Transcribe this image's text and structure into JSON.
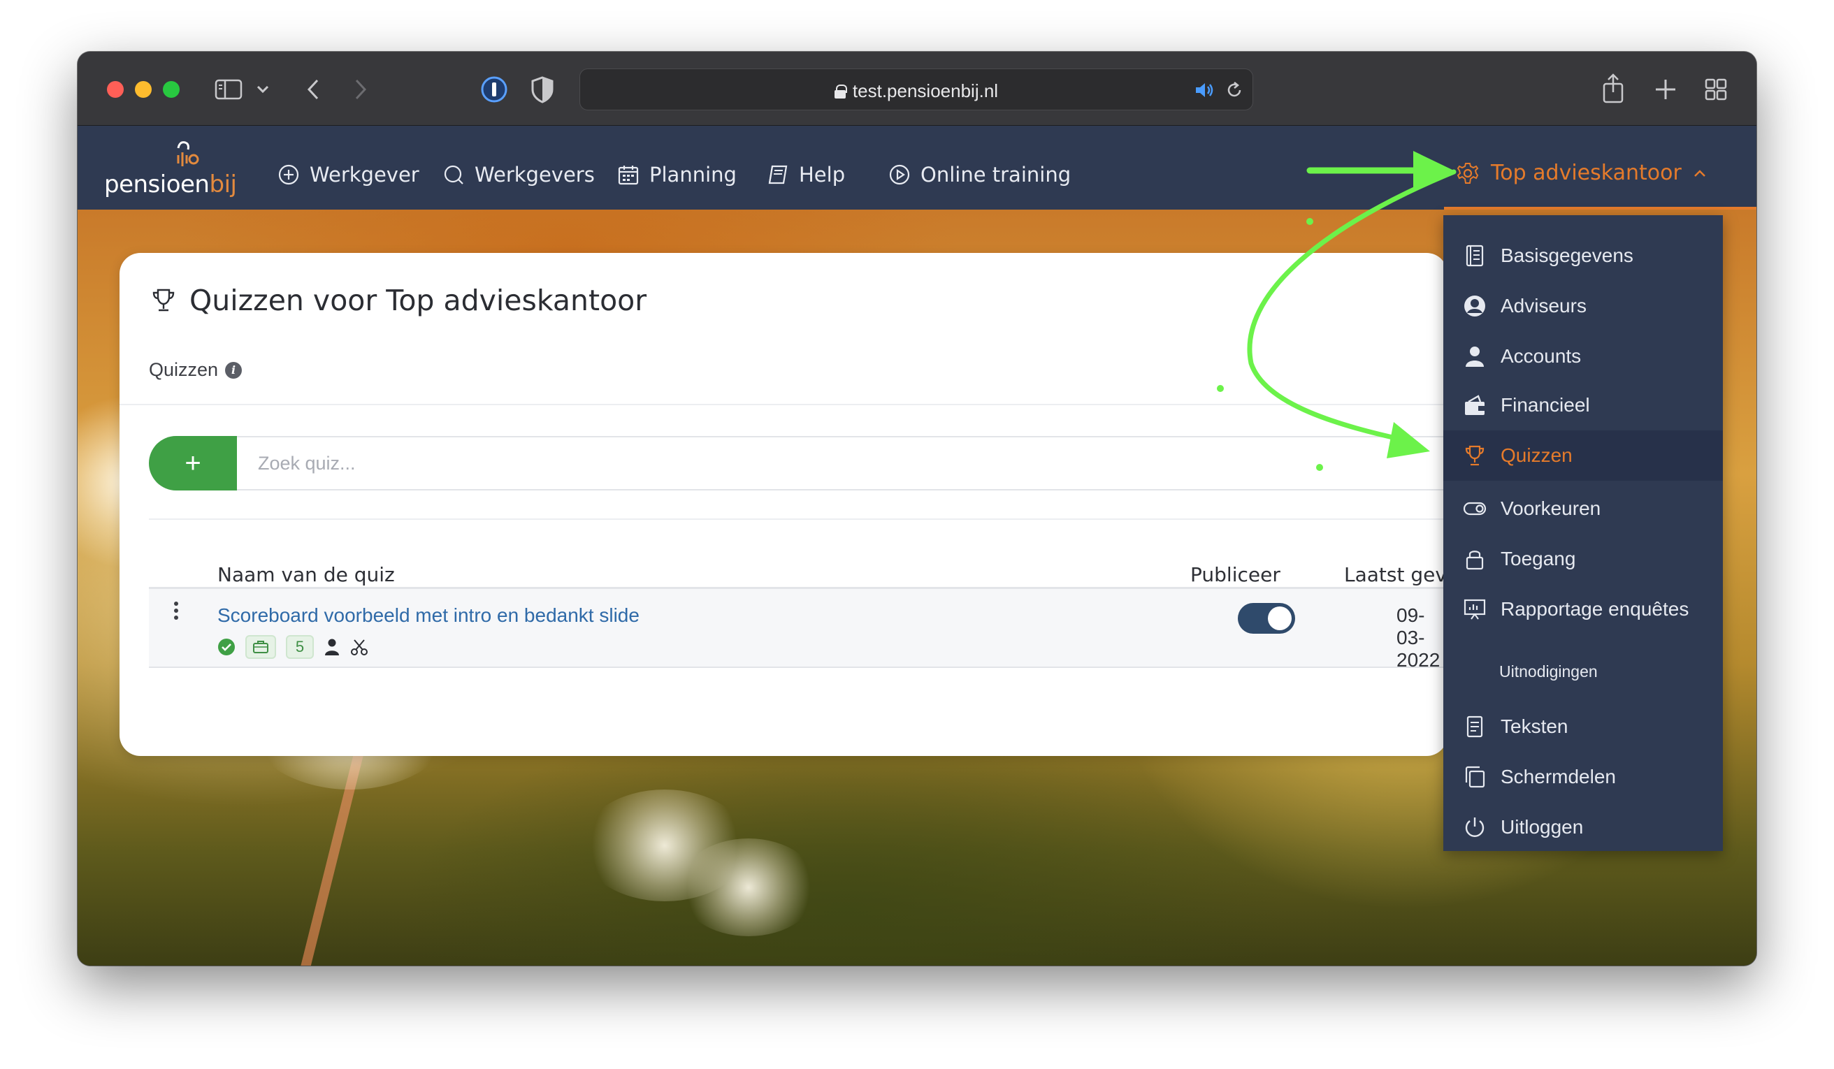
{
  "browser": {
    "url": "test.pensioenbij.nl"
  },
  "app": {
    "logo_main": "pensioen",
    "logo_accent": "bij",
    "nav": [
      {
        "label": "Werkgever",
        "icon": "plus-circle-icon"
      },
      {
        "label": "Werkgevers",
        "icon": "search-icon"
      },
      {
        "label": "Planning",
        "icon": "calendar-icon"
      },
      {
        "label": "Help",
        "icon": "book-icon"
      },
      {
        "label": "Online training",
        "icon": "play-circle-icon"
      }
    ],
    "account_menu_label": "Top advieskantoor",
    "accent_color": "#e57b2b",
    "nav_bg_color": "#2f3a52"
  },
  "card": {
    "title": "Quizzen voor Top advieskantoor",
    "section_label": "Quizzen",
    "add_label": "+",
    "search_placeholder": "Zoek quiz...",
    "columns": [
      "Naam van de quiz",
      "Publiceer",
      "Laatst gev"
    ],
    "rows": [
      {
        "name": "Scoreboard voorbeeld met intro en bedankt slide",
        "count": "5",
        "published": true,
        "last_changed": "09-03-2022"
      }
    ]
  },
  "dropdown": {
    "items": [
      {
        "label": "Basisgegevens",
        "icon": "document-list-icon"
      },
      {
        "label": "Adviseurs",
        "icon": "user-circle-icon"
      },
      {
        "label": "Accounts",
        "icon": "user-icon"
      },
      {
        "label": "Financieel",
        "icon": "wallet-icon"
      },
      {
        "label": "Quizzen",
        "icon": "trophy-icon",
        "active": true
      },
      {
        "label": "Voorkeuren",
        "icon": "toggle-icon"
      },
      {
        "label": "Toegang",
        "icon": "lock-icon"
      },
      {
        "label": "Rapportage enquêtes",
        "icon": "presentation-icon"
      }
    ],
    "section_heading": "Uitnodigingen",
    "section_items": [
      {
        "label": "Teksten",
        "icon": "text-document-icon"
      },
      {
        "label": "Schermdelen",
        "icon": "copy-icon"
      },
      {
        "label": "Uitloggen",
        "icon": "power-icon"
      }
    ]
  },
  "annotation": {
    "arrow_color": "#6cf24a"
  }
}
